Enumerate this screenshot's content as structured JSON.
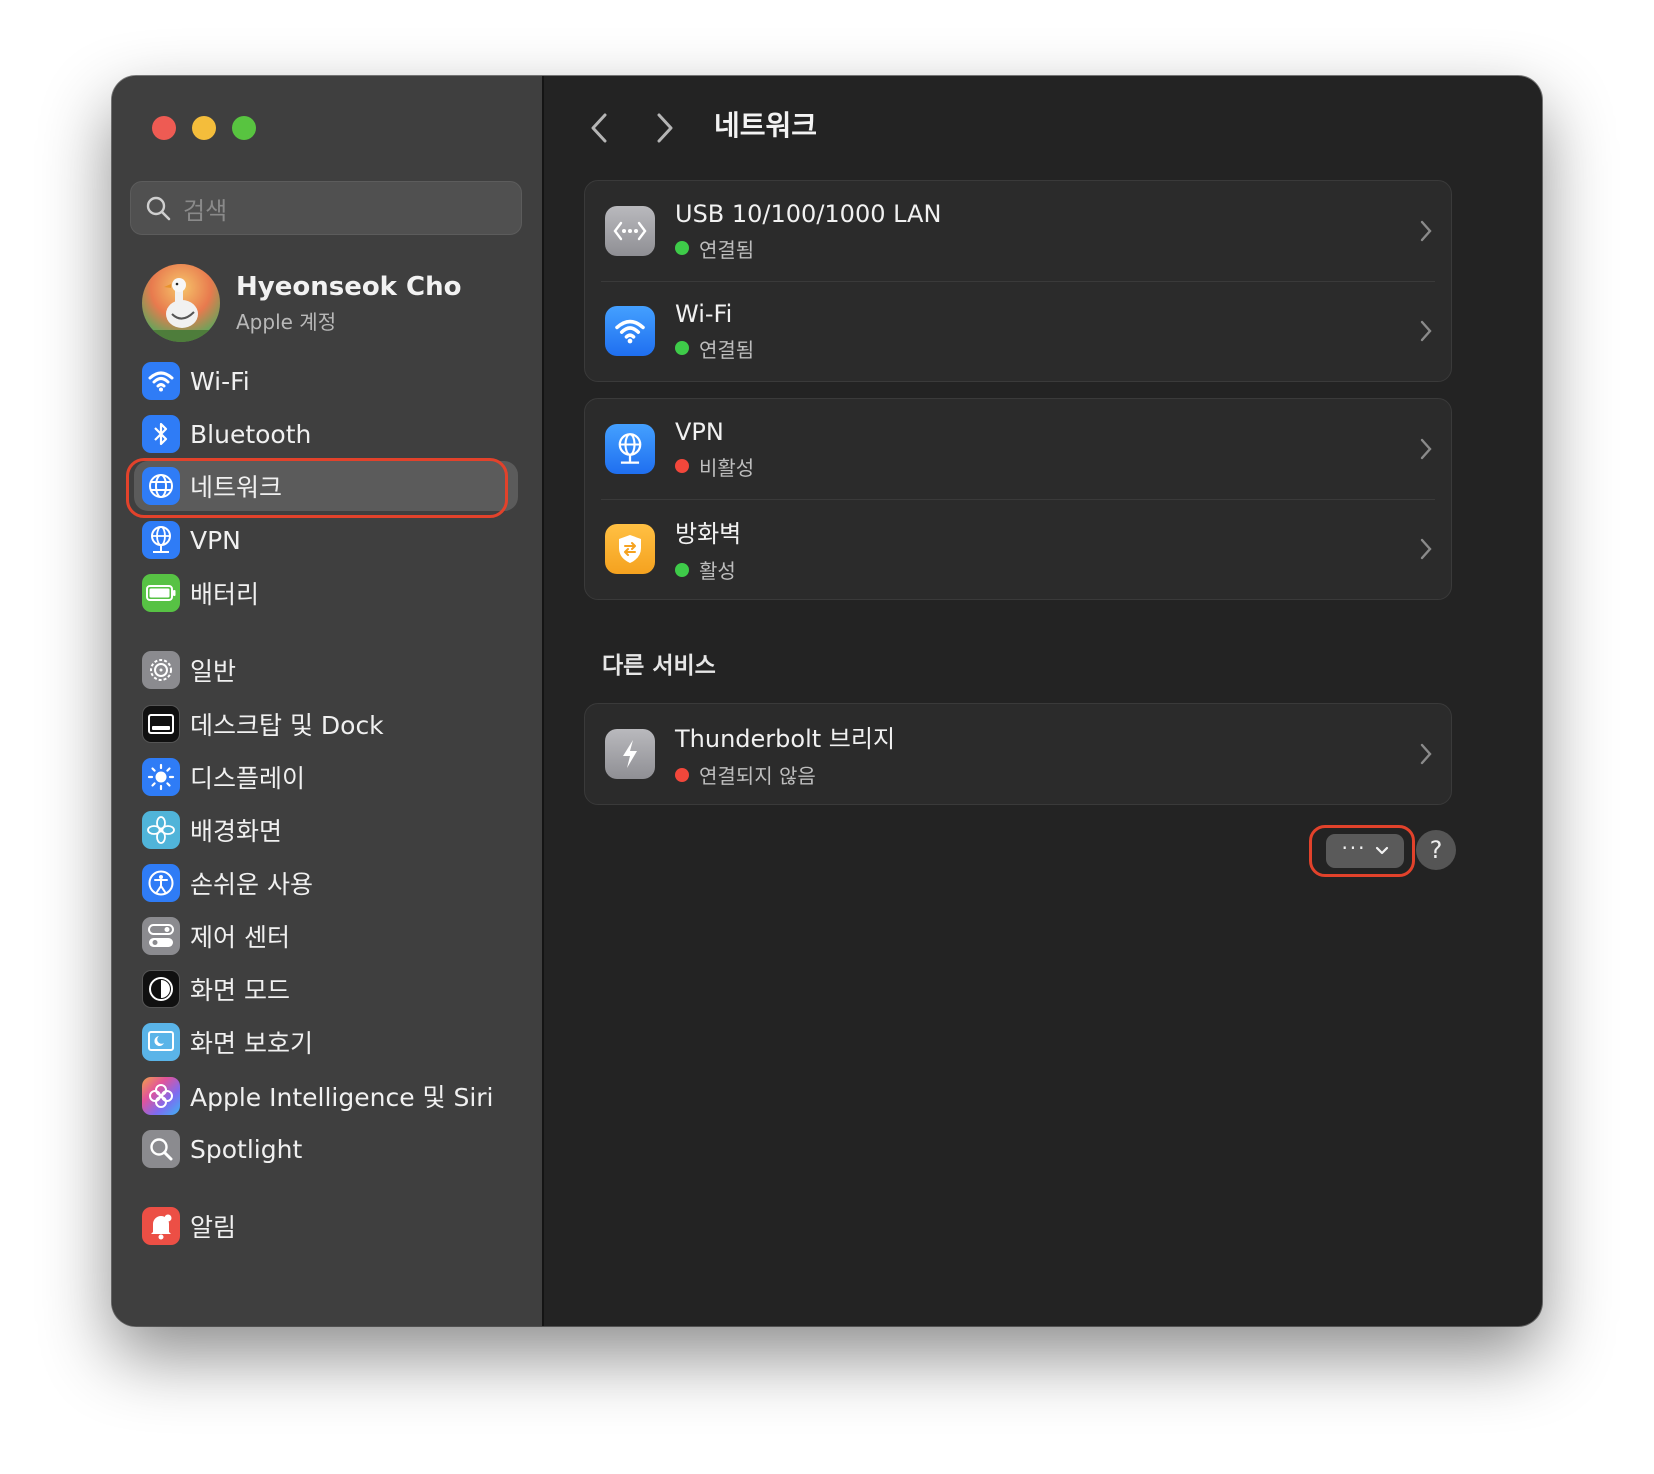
{
  "sidebar": {
    "search": {
      "placeholder": "검색"
    },
    "profile": {
      "name": "Hyeonseok Cho",
      "subtitle": "Apple 계정"
    },
    "items": [
      {
        "label": "Wi-Fi",
        "icon": "wifi-icon",
        "active": false
      },
      {
        "label": "Bluetooth",
        "icon": "bluetooth-icon",
        "active": false
      },
      {
        "label": "네트워크",
        "icon": "globe-icon",
        "active": true
      },
      {
        "label": "VPN",
        "icon": "vpn-globe-icon",
        "active": false
      },
      {
        "label": "배터리",
        "icon": "battery-icon",
        "active": false
      },
      {
        "label": "일반",
        "icon": "gear-icon",
        "active": false
      },
      {
        "label": "데스크탑 및 Dock",
        "icon": "dock-icon",
        "active": false
      },
      {
        "label": "디스플레이",
        "icon": "sun-icon",
        "active": false
      },
      {
        "label": "배경화면",
        "icon": "flower-icon",
        "active": false
      },
      {
        "label": "손쉬운 사용",
        "icon": "accessibility-icon",
        "active": false
      },
      {
        "label": "제어 센터",
        "icon": "toggles-icon",
        "active": false
      },
      {
        "label": "화면 모드",
        "icon": "appearance-icon",
        "active": false
      },
      {
        "label": "화면 보호기",
        "icon": "screensaver-icon",
        "active": false
      },
      {
        "label": "Apple Intelligence 및 Siri",
        "icon": "siri-icon",
        "active": false
      },
      {
        "label": "Spotlight",
        "icon": "magnifier-icon",
        "active": false
      },
      {
        "label": "알림",
        "icon": "bell-icon",
        "active": false
      }
    ]
  },
  "main": {
    "title": "네트워크",
    "groups": [
      {
        "rows": [
          {
            "name": "USB 10/100/1000 LAN",
            "status": "연결됨",
            "status_color": "#3ecb49",
            "icon": "ethernet-icon"
          },
          {
            "name": "Wi-Fi",
            "status": "연결됨",
            "status_color": "#3ecb49",
            "icon": "wifi-icon"
          }
        ]
      },
      {
        "rows": [
          {
            "name": "VPN",
            "status": "비활성",
            "status_color": "#f2473b",
            "icon": "vpn-globe-icon"
          },
          {
            "name": "방화벽",
            "status": "활성",
            "status_color": "#3ecb49",
            "icon": "firewall-shield-icon"
          }
        ]
      }
    ],
    "other_services": {
      "label": "다른 서비스",
      "rows": [
        {
          "name": "Thunderbolt 브리지",
          "status": "연결되지 않음",
          "status_color": "#f2473b",
          "icon": "thunderbolt-icon"
        }
      ]
    },
    "more_button": {
      "label": "···"
    },
    "help_button": {
      "label": "?"
    }
  },
  "colors": {
    "highlight": "#e2422b",
    "accent": "#2f7cf6"
  }
}
